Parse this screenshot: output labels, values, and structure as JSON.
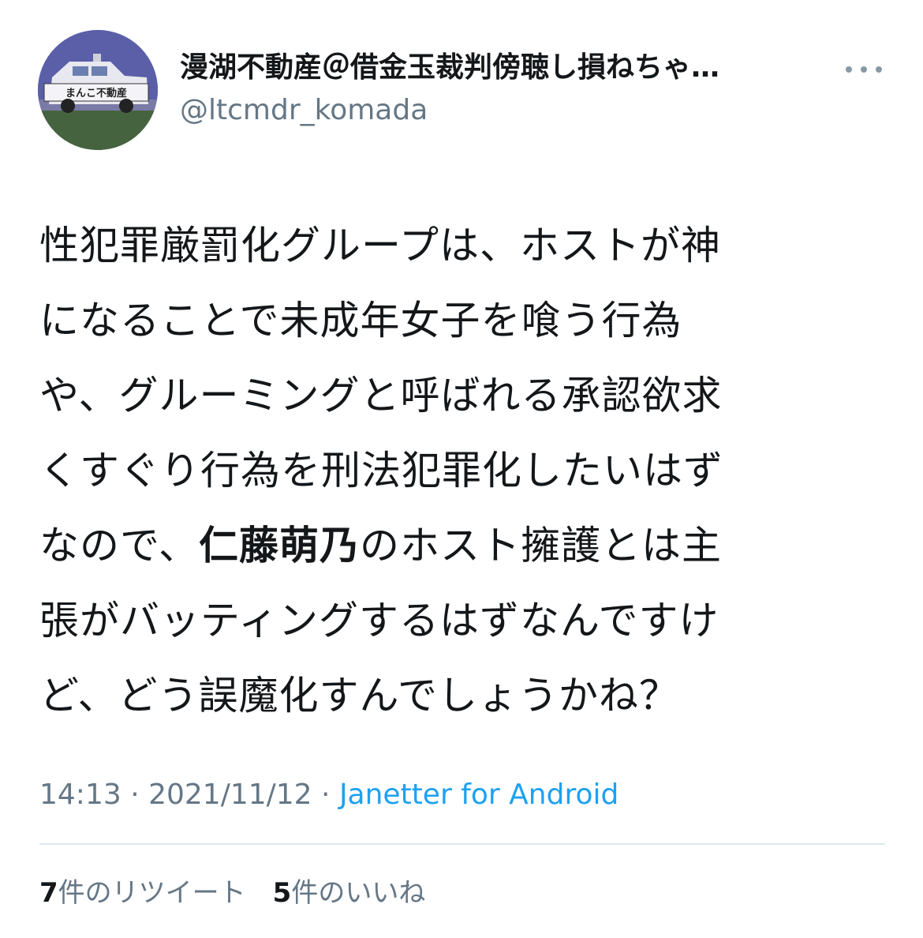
{
  "author": {
    "display_name": "漫湖不動産＠借金玉裁判傍聴し損ねちゃ…",
    "handle": "@ltcmdr_komada",
    "avatar_text": "まんこ不動産"
  },
  "menu_icon": "more-horizontal-icon",
  "tweet": {
    "lines": {
      "l1": "性犯罪厳罰化グループは、ホストが神",
      "l2": "になることで未成年女子を喰う行為",
      "l3": "や、グルーミングと呼ばれる承認欲求",
      "l4": "くすぐり行為を刑法犯罪化したいはず",
      "l5_pre": "なので、",
      "l5_bold": "仁藤萌乃",
      "l5_post": "のホスト擁護とは主",
      "l6": "張がバッティングするはずなんですけ",
      "l7": "ど、どう誤魔化すんでしょうかね？"
    }
  },
  "meta": {
    "time": "14:13",
    "sep1": " · ",
    "date": "2021/11/12",
    "sep2": " · ",
    "source": "Janetter for Android"
  },
  "stats": {
    "retweets_count": "7",
    "retweets_label": "件のリツイート",
    "likes_count": "5",
    "likes_label": "件のいいね"
  },
  "colors": {
    "text": "#14171a",
    "secondary": "#657786",
    "link": "#1da1f2",
    "divider": "#e1e8ed"
  }
}
